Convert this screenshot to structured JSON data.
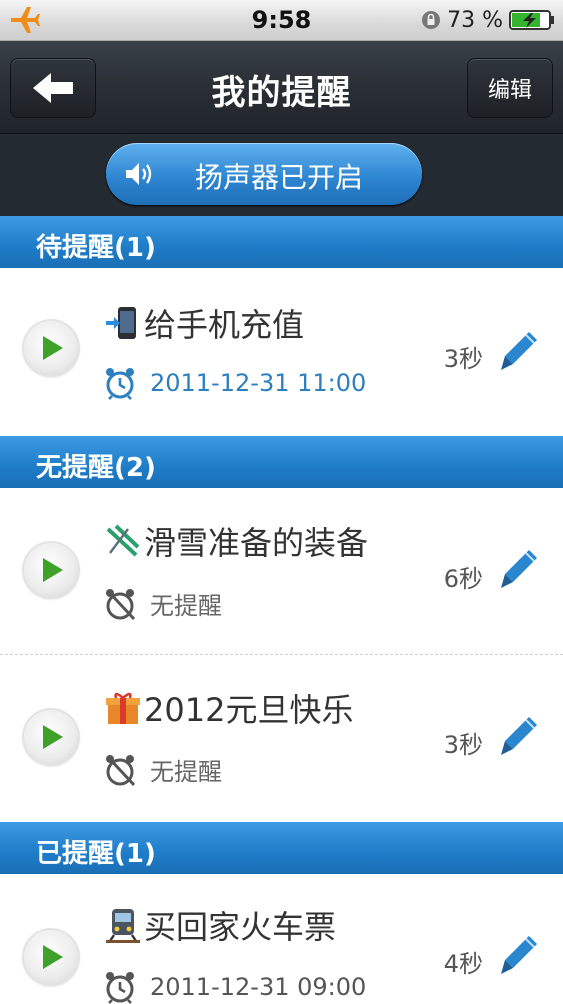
{
  "status_bar": {
    "time": "9:58",
    "battery": "73 %",
    "icons": [
      "airplane-icon",
      "orientation-lock-icon",
      "battery-charging-icon"
    ]
  },
  "nav": {
    "title": "我的提醒",
    "back_icon": "back-arrow-icon",
    "edit_label": "编辑"
  },
  "toolbar": {
    "speaker_label": "扬声器已开启",
    "speaker_icon": "speaker-icon"
  },
  "sections": [
    {
      "header": "待提醒(1)",
      "items": [
        {
          "title": "给手机充值",
          "icon": "phone-charge-icon",
          "subtitle": "2011-12-31 11:00",
          "alarm": true,
          "duration": "3秒"
        }
      ]
    },
    {
      "header": "无提醒(2)",
      "items": [
        {
          "title": "滑雪准备的装备",
          "icon": "ski-icon",
          "subtitle": "无提醒",
          "alarm": false,
          "duration": "6秒"
        },
        {
          "title": "2012元旦快乐",
          "icon": "gift-icon",
          "subtitle": "无提醒",
          "alarm": false,
          "duration": "3秒"
        }
      ]
    },
    {
      "header": "已提醒(1)",
      "items": [
        {
          "title": "买回家火车票",
          "icon": "train-icon",
          "subtitle": "2011-12-31 09:00",
          "alarm": true,
          "duration": "4秒"
        }
      ]
    }
  ],
  "colors": {
    "section_blue": "#1f7cc8",
    "alarm_text_blue": "#2d7fbf",
    "play_green": "#3ea12a",
    "pencil_blue": "#2a86cf"
  }
}
